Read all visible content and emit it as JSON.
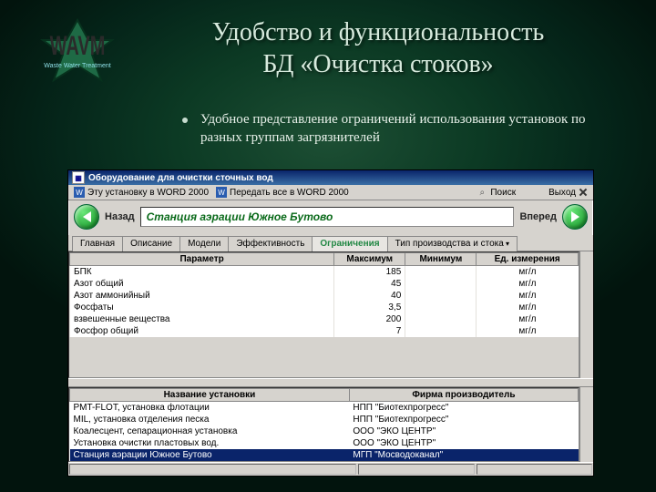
{
  "slide": {
    "title_l1": "Удобство и функциональность",
    "title_l2": "БД «Очистка стоков»",
    "bullet": "Удобное представление ограничений использования установок по разных группам загрязнителей"
  },
  "logo": {
    "top": "WAVM",
    "bottom": "Waste Water Treatment"
  },
  "window": {
    "title": "Оборудование для очистки сточных вод",
    "toolbar": {
      "to_word_one": "Эту установку в WORD 2000",
      "to_word_all": "Передать все в WORD 2000",
      "search": "Поиск",
      "exit": "Выход"
    },
    "nav": {
      "back": "Назад",
      "forward": "Вперед"
    },
    "station": "Станция аэрации Южное Бутово",
    "tabs": [
      "Главная",
      "Описание",
      "Модели",
      "Эффективность",
      "Ограничения",
      "Тип производства и стока"
    ],
    "active_tab": 4,
    "params": {
      "headers": {
        "name": "Параметр",
        "max": "Максимум",
        "min": "Минимум",
        "unit": "Ед. измерения"
      },
      "rows": [
        {
          "name": "БПК",
          "max": "185",
          "min": "",
          "unit": "мг/л"
        },
        {
          "name": "Азот общий",
          "max": "45",
          "min": "",
          "unit": "мг/л"
        },
        {
          "name": "Азот аммонийный",
          "max": "40",
          "min": "",
          "unit": "мг/л"
        },
        {
          "name": "Фосфаты",
          "max": "3,5",
          "min": "",
          "unit": "мг/л"
        },
        {
          "name": "взвешенные вещества",
          "max": "200",
          "min": "",
          "unit": "мг/л"
        },
        {
          "name": "Фосфор общий",
          "max": "7",
          "min": "",
          "unit": "мг/л"
        }
      ]
    },
    "unitlist": {
      "headers": {
        "name": "Название установки",
        "maker": "Фирма производитель"
      },
      "rows": [
        {
          "name": "PMT-FLOT, установка флотации",
          "maker": "НПП \"Биотехпрогресс\""
        },
        {
          "name": "MIL, установка отделения песка",
          "maker": "НПП \"Биотехпрогресс\""
        },
        {
          "name": "Коалесцент, сепарационная установка",
          "maker": "ООО \"ЭКО ЦЕНТР\""
        },
        {
          "name": "Установка очистки пластовых вод.",
          "maker": "ООО \"ЭКО ЦЕНТР\""
        },
        {
          "name": "Станция аэрации Южное Бутово",
          "maker": "МГП \"Мосводоканал\""
        }
      ],
      "selected": 4
    }
  }
}
